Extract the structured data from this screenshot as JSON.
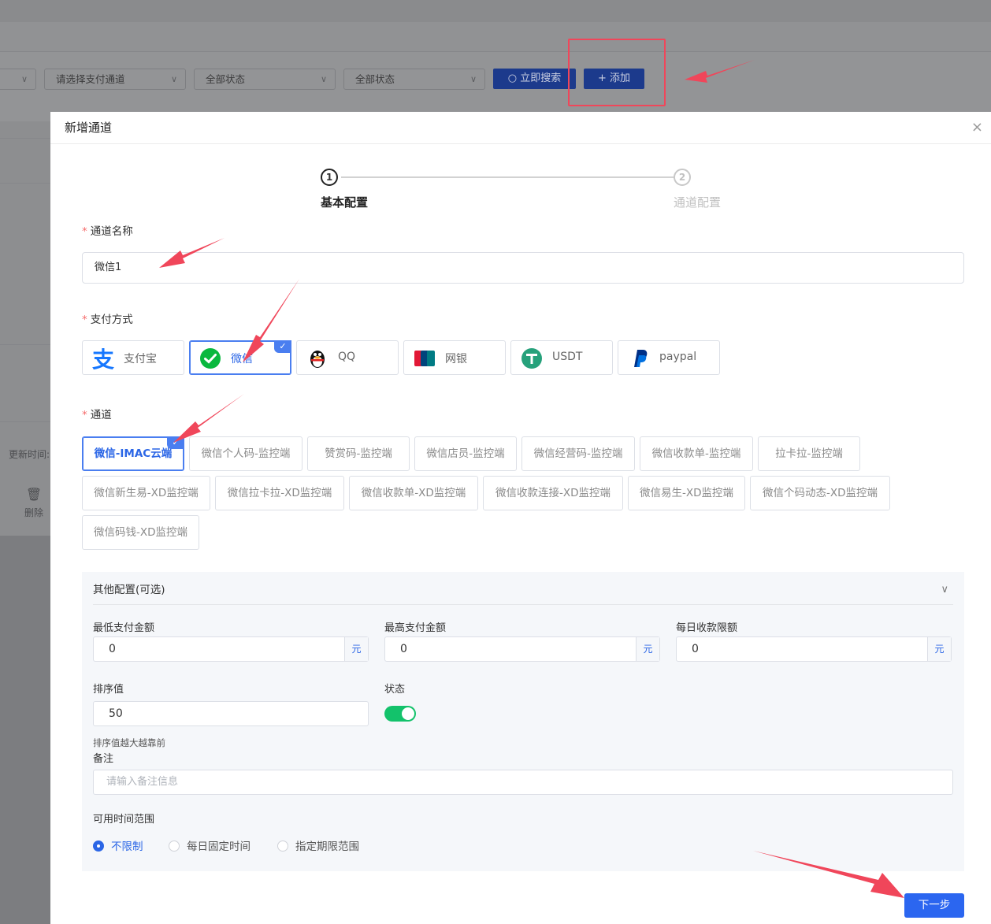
{
  "background": {
    "filters": [
      {
        "label": "",
        "name": "filter-select-1"
      },
      {
        "label": "请选择支付通道",
        "name": "filter-channel-select"
      },
      {
        "label": "全部状态",
        "name": "filter-status-select-1"
      },
      {
        "label": "全部状态",
        "name": "filter-status-select-2"
      }
    ],
    "search_label": "立即搜索",
    "add_label": "添加",
    "update_time_label": "更新时间:",
    "delete_label": "删除"
  },
  "modal": {
    "title": "新增通道",
    "close": "×",
    "steps": [
      {
        "num": "1",
        "label": "基本配置"
      },
      {
        "num": "2",
        "label": "通道配置"
      }
    ],
    "channel_name_label": "通道名称",
    "channel_name_value": "微信1",
    "pay_method_label": "支付方式",
    "pay_methods": [
      "支付宝",
      "微信",
      "QQ",
      "网银",
      "USDT",
      "paypal"
    ],
    "pay_selected": "微信",
    "channel_label": "通道",
    "channels": [
      "微信-IMAC云端",
      "微信个人码-监控端",
      "赞赏码-监控端",
      "微信店员-监控端",
      "微信经营码-监控端",
      "微信收款单-监控端",
      "拉卡拉-监控端",
      "微信新生易-XD监控端",
      "微信拉卡拉-XD监控端",
      "微信收款单-XD监控端",
      "微信收款连接-XD监控端",
      "微信易生-XD监控端",
      "微信个码动态-XD监控端",
      "微信码钱-XD监控端"
    ],
    "channel_selected": "微信-IMAC云端",
    "other": {
      "title": "其他配置(可选)",
      "min_label": "最低支付金额",
      "min_value": "0",
      "max_label": "最高支付金额",
      "max_value": "0",
      "daily_label": "每日收款限额",
      "daily_value": "0",
      "unit": "元",
      "sort_label": "排序值",
      "sort_value": "50",
      "sort_hint": "排序值越大越靠前",
      "status_label": "状态",
      "status_on": true,
      "remark_label": "备注",
      "remark_placeholder": "请输入备注信息",
      "time_range_label": "可用时间范围",
      "time_options": [
        "不限制",
        "每日固定时间",
        "指定期限范围"
      ],
      "time_selected": "不限制"
    },
    "next_label": "下一步"
  },
  "colors": {
    "primary": "#2b66f0",
    "toggle_on": "#13c26b",
    "annotation": "#f0465a"
  }
}
